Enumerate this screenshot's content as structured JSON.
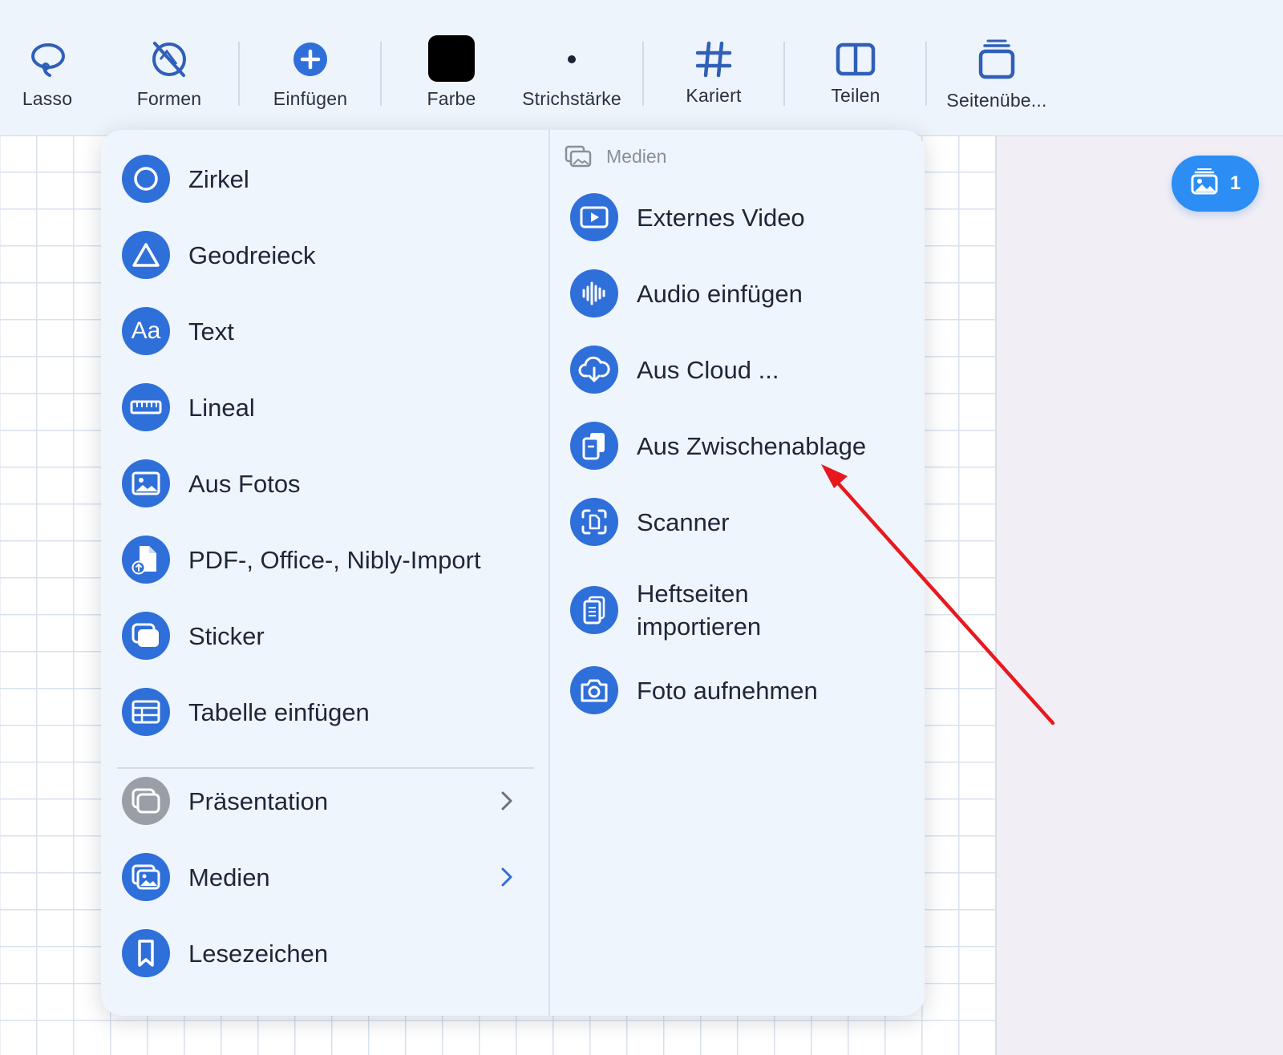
{
  "toolbar": {
    "lasso": "Lasso",
    "formen": "Formen",
    "einfuegen": "Einfügen",
    "farbe": "Farbe",
    "strichstaerke": "Strichstärke",
    "kariert": "Kariert",
    "teilen": "Teilen",
    "seitenuebersicht": "Seitenübe..."
  },
  "media_badge": {
    "count": "1",
    "icon": "stack-photo-icon"
  },
  "insert_menu": {
    "left_items": [
      {
        "label": "Zirkel",
        "icon": "circle-icon"
      },
      {
        "label": "Geodreieck",
        "icon": "triangle-icon"
      },
      {
        "label": "Text",
        "icon": "text-aa-icon"
      },
      {
        "label": "Lineal",
        "icon": "ruler-icon"
      },
      {
        "label": "Aus Fotos",
        "icon": "photo-icon"
      },
      {
        "label": "PDF-, Office-, Nibly-Import",
        "icon": "document-import-icon"
      },
      {
        "label": "Sticker",
        "icon": "sticker-icon"
      },
      {
        "label": "Tabelle einfügen",
        "icon": "table-icon"
      }
    ],
    "submenus": [
      {
        "label": "Präsentation",
        "icon": "presentation-icon"
      },
      {
        "label": "Medien",
        "icon": "media-icon"
      }
    ],
    "bookmark": {
      "label": "Lesezeichen",
      "icon": "bookmark-icon"
    },
    "media_section": {
      "title": "Medien",
      "items": [
        {
          "label": "Externes Video",
          "icon": "video-play-icon"
        },
        {
          "label": "Audio einfügen",
          "icon": "audio-wave-icon"
        },
        {
          "label": "Aus Cloud ...",
          "icon": "cloud-download-icon"
        },
        {
          "label": "Aus Zwischenablage",
          "icon": "clipboard-icon"
        },
        {
          "label": "Scanner",
          "icon": "scanner-icon"
        },
        {
          "label": "Heftseiten importieren",
          "icon": "notebook-pages-icon"
        },
        {
          "label": "Foto aufnehmen",
          "icon": "camera-icon"
        }
      ]
    }
  },
  "colors": {
    "accent": "#2f6fd9",
    "badge": "#2c8ef4",
    "annotation_arrow": "#e8191e",
    "selected_color_swatch": "#000000"
  }
}
